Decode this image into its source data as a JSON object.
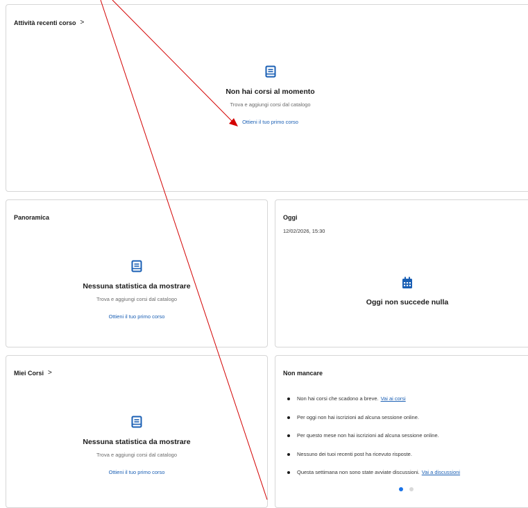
{
  "recent": {
    "title": "Attività recenti corso",
    "chevron": ">",
    "icon": "book-icon",
    "heading": "Non hai corsi al momento",
    "subtitle": "Trova e aggiungi corsi dal catalogo",
    "link": "Ottieni il tuo primo corso"
  },
  "overview": {
    "title": "Panoramica",
    "icon": "book-icon",
    "heading": "Nessuna statistica da mostrare",
    "subtitle": "Trova e aggiungi corsi dal catalogo",
    "link": "Ottieni il tuo primo corso"
  },
  "today": {
    "title": "Oggi",
    "datetime": "12/02/2026, 15:30",
    "icon": "calendar-icon",
    "heading": "Oggi non succede nulla"
  },
  "my_courses": {
    "title": "Miei Corsi",
    "chevron": ">",
    "icon": "book-icon",
    "heading": "Nessuna statistica da mostrare",
    "subtitle": "Trova e aggiungi corsi dal catalogo",
    "link": "Ottieni il tuo primo corso"
  },
  "dont_miss": {
    "title": "Non mancare",
    "items": [
      {
        "text": "Non hai corsi che scadono a breve.",
        "link": "Vai ai corsi"
      },
      {
        "text": "Per oggi non hai iscrizioni ad alcuna sessione online.",
        "link": ""
      },
      {
        "text": "Per questo mese non hai iscrizioni ad alcuna sessione online.",
        "link": ""
      },
      {
        "text": "Nessuno dei tuoi recenti post ha ricevuto risposte.",
        "link": ""
      },
      {
        "text": "Questa settimana non sono state avviate discussioni.",
        "link": "Vai a discussioni"
      }
    ],
    "pager_active": 1,
    "pager_total": 2
  },
  "colors": {
    "accent": "#1a5fb4",
    "annotation": "#d40000"
  }
}
